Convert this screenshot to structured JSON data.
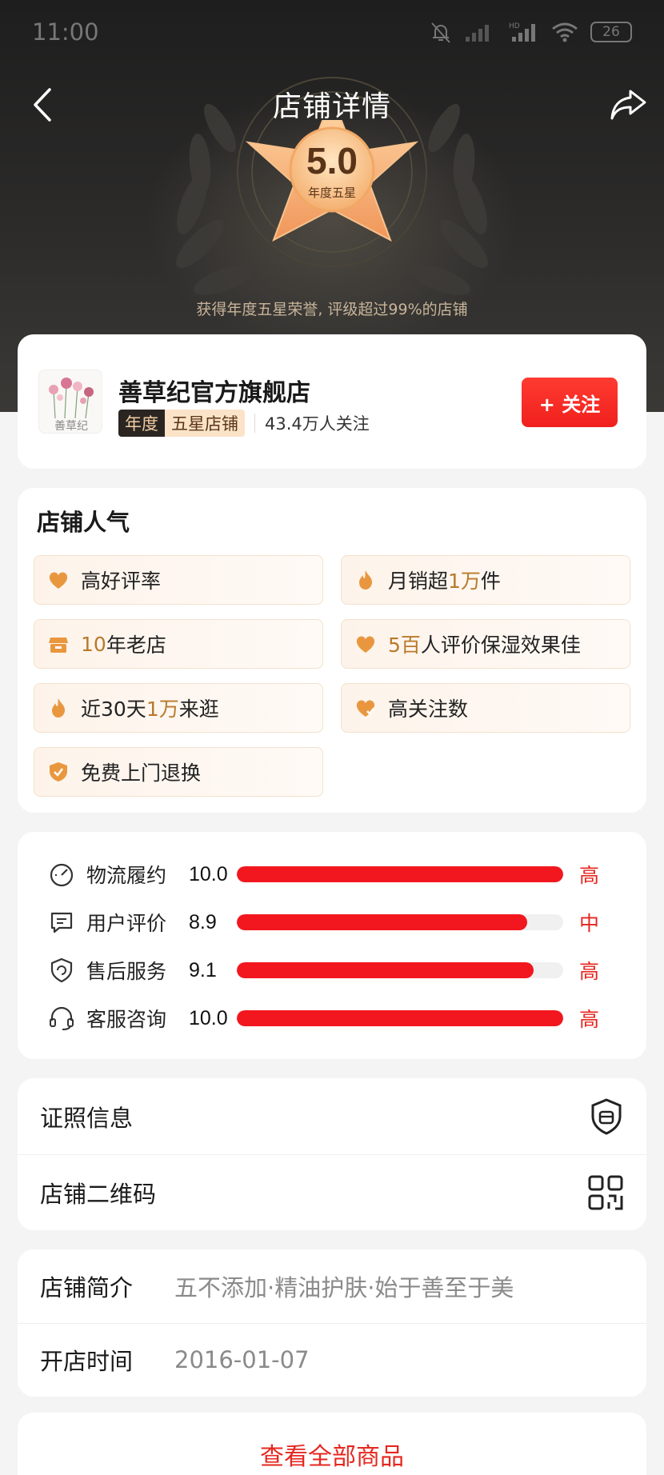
{
  "status_bar": {
    "time": "11:00",
    "battery": "26"
  },
  "nav": {
    "title": "店铺详情"
  },
  "badge": {
    "rating": "5.0",
    "label": "年度五星"
  },
  "honor_text": "获得年度五星荣誉, 评级超过99%的店铺",
  "store": {
    "name": "善草纪官方旗舰店",
    "tag_year": "年度",
    "tag_star": "五星店铺",
    "followers": "43.4万人关注",
    "follow_button": "+ 关注",
    "logo_text": "善草纪"
  },
  "popularity": {
    "title": "店铺人气",
    "chips": [
      {
        "icon": "heart-icon",
        "pre": "高好评率",
        "hl": "",
        "post": ""
      },
      {
        "icon": "flame-icon",
        "pre": "月销超",
        "hl": "1万",
        "post": "件"
      },
      {
        "icon": "shop-icon",
        "pre": "",
        "hl": "10",
        "post": "年老店"
      },
      {
        "icon": "heart-icon",
        "pre": "",
        "hl": "5百",
        "post": "人评价保湿效果佳"
      },
      {
        "icon": "flame-icon",
        "pre": "近30天",
        "hl": "1万",
        "post": "来逛"
      },
      {
        "icon": "heart-check-icon",
        "pre": "高关注数",
        "hl": "",
        "post": ""
      },
      {
        "icon": "shield-check-icon",
        "pre": "免费上门退换",
        "hl": "",
        "post": ""
      }
    ]
  },
  "scores": [
    {
      "icon": "speedometer-icon",
      "label": "物流履约",
      "value": "10.0",
      "fraction": 1.0,
      "level": "高"
    },
    {
      "icon": "chat-icon",
      "label": "用户评价",
      "value": "8.9",
      "fraction": 0.89,
      "level": "中"
    },
    {
      "icon": "service-shield-icon",
      "label": "售后服务",
      "value": "9.1",
      "fraction": 0.91,
      "level": "高"
    },
    {
      "icon": "headset-icon",
      "label": "客服咨询",
      "value": "10.0",
      "fraction": 1.0,
      "level": "高"
    }
  ],
  "links": {
    "license": "证照信息",
    "qrcode": "店铺二维码"
  },
  "info": {
    "intro_key": "店铺简介",
    "intro_val": "五不添加·精油护肤·始于善至于美",
    "open_key": "开店时间",
    "open_val": "2016-01-07"
  },
  "view_all": "查看全部商品",
  "colors": {
    "accent": "#e5271f",
    "highlight": "#b87a2a",
    "bar": "#f2171e"
  }
}
